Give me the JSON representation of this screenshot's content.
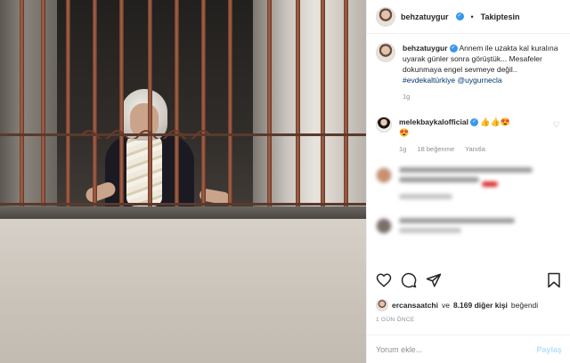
{
  "header": {
    "username": "behzatuygur",
    "follow_status": "Takiptesin"
  },
  "caption": {
    "username": "behzatuygur",
    "text": "Annem ile uzakta kal kuralına uyarak günler sonra görüştük... Mesafeler dokunmaya engel sevmeye değil..",
    "hashtag": "#evdekaltürkiye",
    "mention": "@uygurnecla",
    "time": "1g"
  },
  "comment": {
    "username": "melekbaykalofficial",
    "emojis": "👍👍😍",
    "emoji2": "😍",
    "time": "1g",
    "likes": "18 beğenme",
    "reply": "Yanıtla"
  },
  "likes": {
    "user": "ercansaatchi",
    "connector": "ve",
    "others": "8.169 diğer kişi",
    "suffix": "beğendi"
  },
  "time_ago": "1 GÜN ÖNCE",
  "comment_input": {
    "placeholder": "Yorum ekle...",
    "post_label": "Paylaş"
  },
  "colors": {
    "link": "#00376b",
    "verified": "#3897f0",
    "post_disabled": "#b2dffc"
  }
}
